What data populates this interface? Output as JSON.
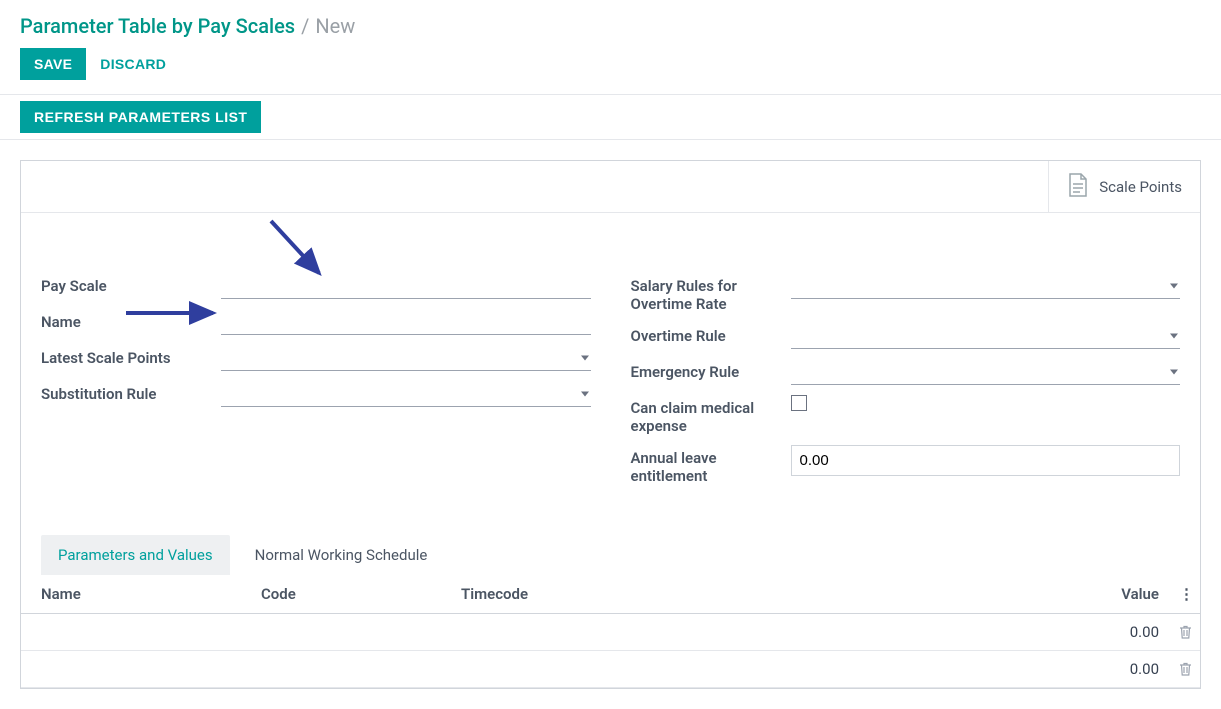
{
  "breadcrumb": {
    "root": "Parameter Table by Pay Scales",
    "sep": "/",
    "current": "New"
  },
  "actions": {
    "save": "SAVE",
    "discard": "DISCARD"
  },
  "refresh": {
    "label": "REFRESH PARAMETERS LIST"
  },
  "stat": {
    "scale_points": "Scale Points"
  },
  "form": {
    "left": {
      "pay_scale": {
        "label": "Pay Scale",
        "value": ""
      },
      "name": {
        "label": "Name",
        "value": ""
      },
      "latest_points": {
        "label": "Latest Scale Points",
        "value": ""
      },
      "substitution_rule": {
        "label": "Substitution Rule",
        "value": ""
      }
    },
    "right": {
      "salary_rules": {
        "label": "Salary Rules for Overtime Rate",
        "value": ""
      },
      "overtime_rule": {
        "label": "Overtime Rule",
        "value": ""
      },
      "emergency_rule": {
        "label": "Emergency Rule",
        "value": ""
      },
      "can_claim_medical": {
        "label": "Can claim medical expense",
        "checked": false
      },
      "annual_leave": {
        "label": "Annual leave entitlement",
        "value": "0.00"
      }
    }
  },
  "tabs": {
    "params": "Parameters and Values",
    "schedule": "Normal Working Schedule"
  },
  "table": {
    "headers": {
      "name": "Name",
      "code": "Code",
      "timecode": "Timecode",
      "value": "Value"
    },
    "rows": [
      {
        "name": "",
        "code": "",
        "timecode": "",
        "value": "0.00"
      },
      {
        "name": "",
        "code": "",
        "timecode": "",
        "value": "0.00"
      }
    ]
  }
}
